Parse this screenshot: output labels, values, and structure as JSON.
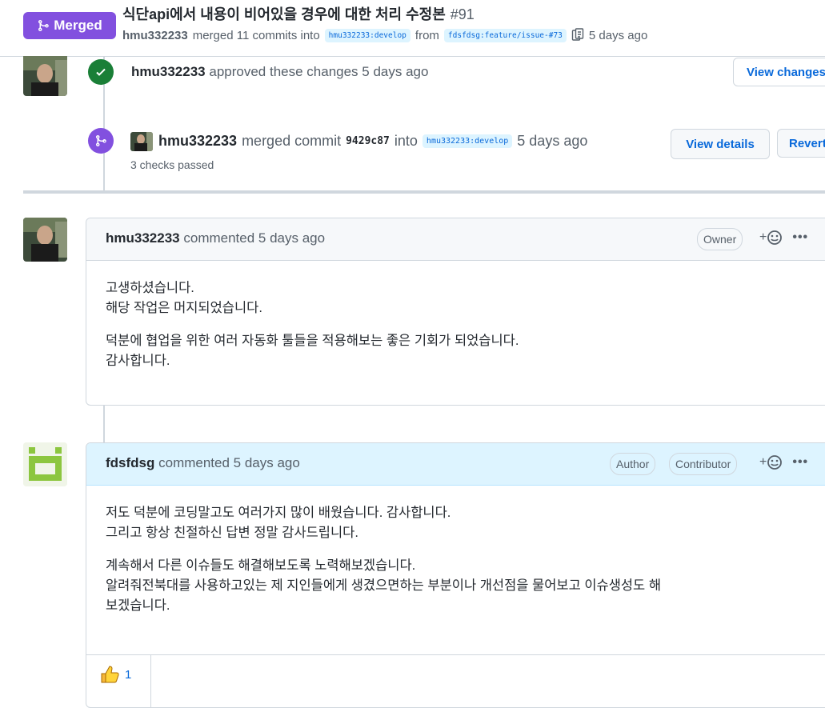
{
  "header": {
    "status": "Merged",
    "title": "식단api에서 내용이 비어있을 경우에 대한 처리 수정본",
    "number": "#91",
    "meta": {
      "user": "hmu332233",
      "action": "merged 11 commits into",
      "base_branch": "hmu332233:develop",
      "from_word": "from",
      "head_branch": "fdsfdsg:feature/issue-#73",
      "time": "5 days ago"
    }
  },
  "timeline": {
    "approval": {
      "user": "hmu332233",
      "text": "approved these changes 5 days ago",
      "button": "View changes"
    },
    "merge_event": {
      "user": "hmu332233",
      "action": "merged commit",
      "commit": "9429c87",
      "into": "into",
      "branch": "hmu332233:develop",
      "time": "5 days ago",
      "checks": "3 checks passed",
      "details_button": "View details",
      "revert_button": "Revert"
    },
    "comments": [
      {
        "author": "hmu332233",
        "header_suffix": "commented 5 days ago",
        "roles": [
          "Owner"
        ],
        "paragraphs": [
          [
            "고생하셨습니다.",
            "해당 작업은 머지되었습니다."
          ],
          [
            "덕분에 협업을 위한 여러 자동화 툴들을 적용해보는 좋은 기회가 되었습니다.",
            "감사합니다."
          ]
        ]
      },
      {
        "author": "fdsfdsg",
        "header_suffix": "commented 5 days ago",
        "roles": [
          "Author",
          "Contributor"
        ],
        "paragraphs": [
          [
            "저도 덕분에 코딩말고도 여러가지 많이 배웠습니다. 감사합니다.",
            "그리고 항상 친절하신 답변 정말 감사드립니다."
          ],
          [
            "계속해서 다른 이슈들도 해결해보도록 노력해보겠습니다.",
            "알려줘전북대를 사용하고있는 제 지인들에게 생겼으면하는 부분이나 개선점을 물어보고 이슈생성도 해",
            "보겠습니다."
          ]
        ],
        "reactions": [
          {
            "icon": "thumbs-up-icon",
            "count": "1"
          }
        ]
      }
    ]
  },
  "colors": {
    "merged_purple": "#8250df",
    "approved_green": "#1a7f37",
    "link_blue": "#0969da"
  }
}
